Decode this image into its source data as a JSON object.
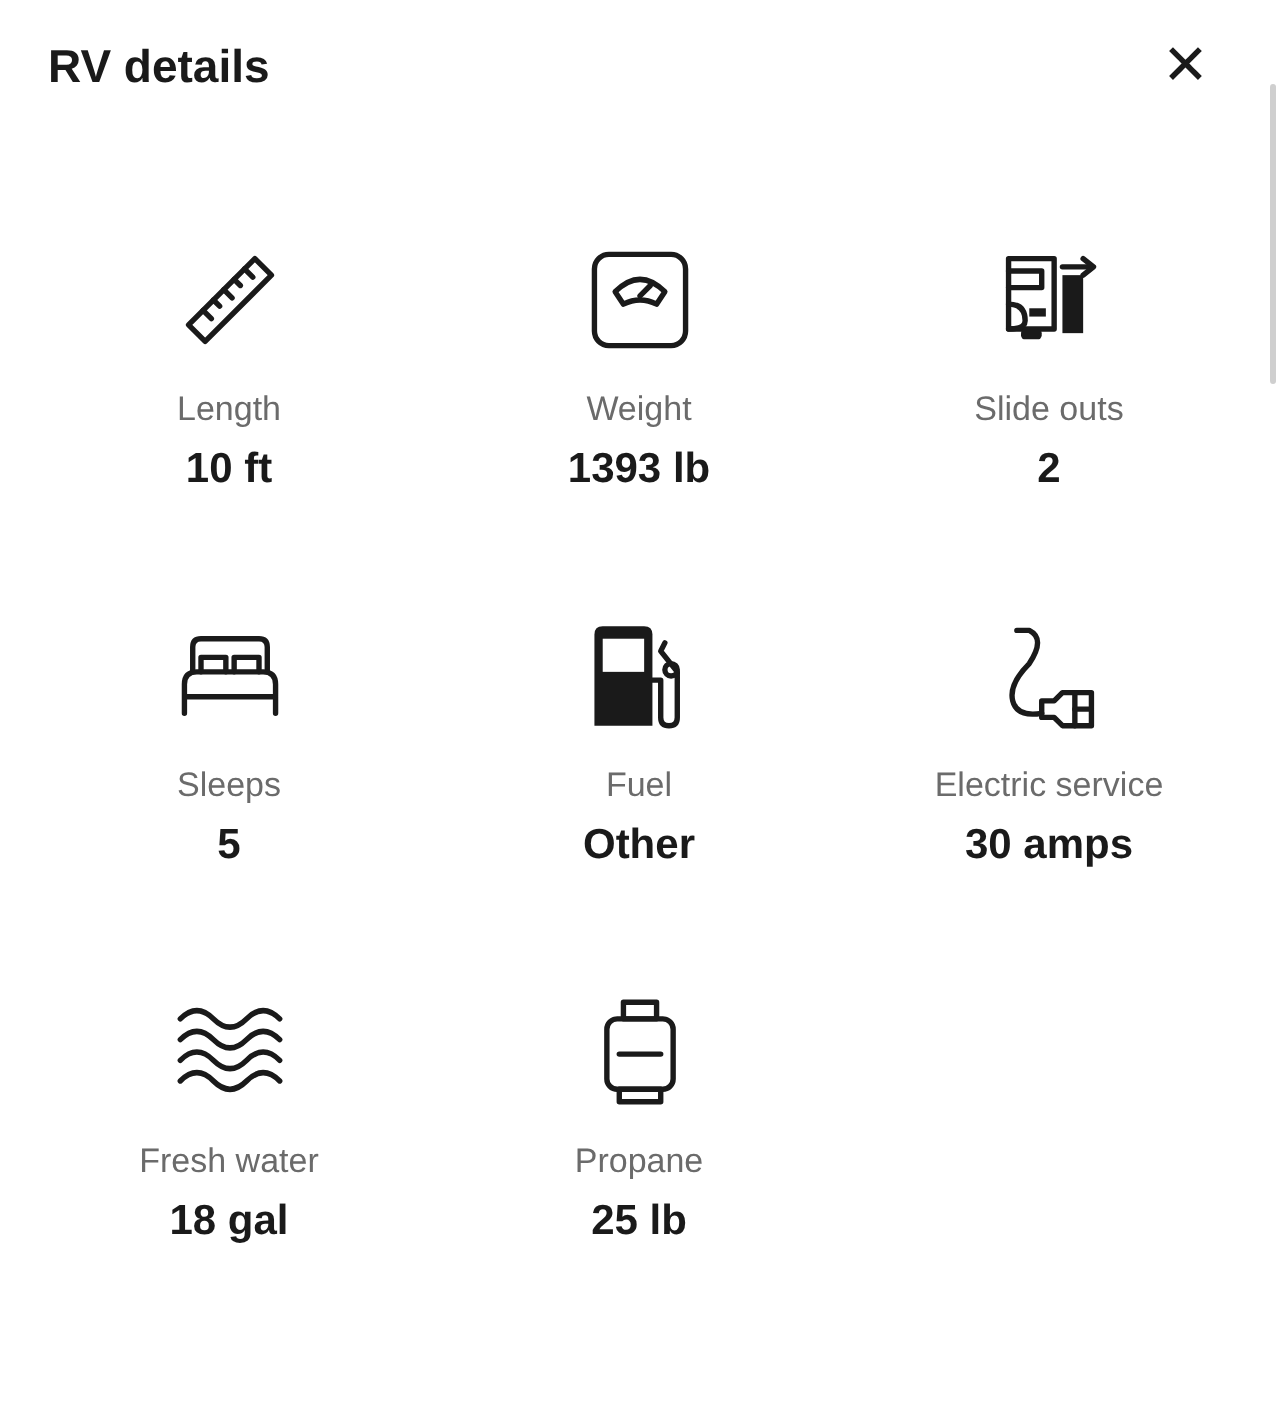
{
  "title": "RV details",
  "close": "✕",
  "details": [
    {
      "kind": "ruler",
      "label": "Length",
      "value": "10 ft"
    },
    {
      "kind": "scale",
      "label": "Weight",
      "value": "1393 lb"
    },
    {
      "kind": "slideout",
      "label": "Slide outs",
      "value": "2"
    },
    {
      "kind": "bed",
      "label": "Sleeps",
      "value": "5"
    },
    {
      "kind": "pump",
      "label": "Fuel",
      "value": "Other"
    },
    {
      "kind": "plug",
      "label": "Electric service",
      "value": "30 amps"
    },
    {
      "kind": "water",
      "label": "Fresh water",
      "value": "18 gal"
    },
    {
      "kind": "tank",
      "label": "Propane",
      "value": "25 lb"
    }
  ]
}
